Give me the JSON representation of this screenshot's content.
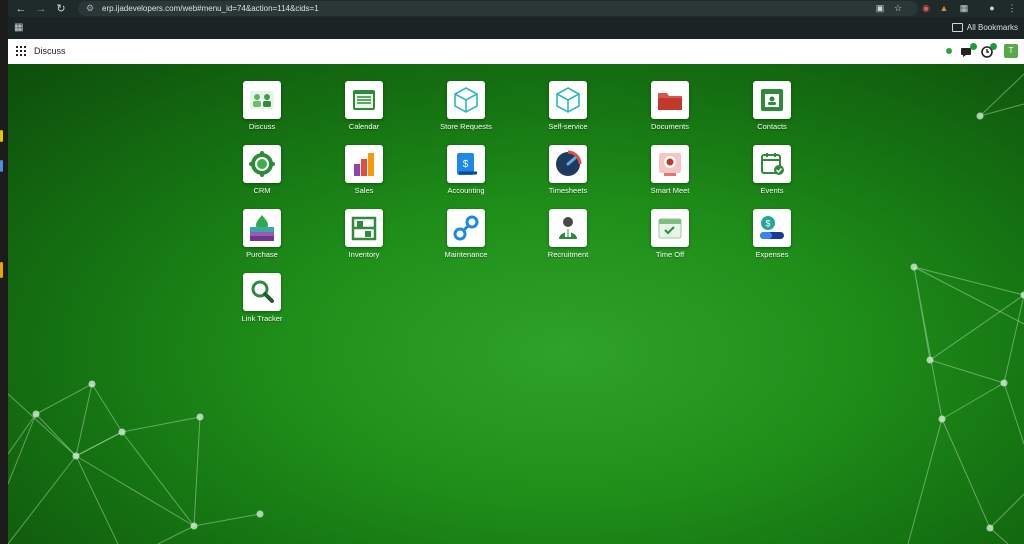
{
  "browser": {
    "url": "erp.ijadevelopers.com/web#menu_id=74&action=114&cids=1",
    "all_bookmarks_label": "All Bookmarks",
    "back_icon": "arrow-left",
    "forward_icon": "arrow-right",
    "reload_icon": "reload"
  },
  "navbar": {
    "title": "Discuss",
    "messages_badge": "",
    "activity_badge": "",
    "avatar_letter": "T",
    "presence_color": "#28a745"
  },
  "apps": [
    {
      "label": "Discuss",
      "icon": "discuss-icon"
    },
    {
      "label": "Calendar",
      "icon": "calendar-icon"
    },
    {
      "label": "Store Requests",
      "icon": "cube-icon"
    },
    {
      "label": "Self-service",
      "icon": "cube-icon"
    },
    {
      "label": "Documents",
      "icon": "folder-icon"
    },
    {
      "label": "Contacts",
      "icon": "contact-card-icon"
    },
    {
      "label": "CRM",
      "icon": "crm-icon"
    },
    {
      "label": "Sales",
      "icon": "bar-chart-icon"
    },
    {
      "label": "Accounting",
      "icon": "dollar-document-icon"
    },
    {
      "label": "Timesheets",
      "icon": "clock-icon"
    },
    {
      "label": "Smart Meet",
      "icon": "camera-icon"
    },
    {
      "label": "Events",
      "icon": "calendar-check-icon"
    },
    {
      "label": "Purchase",
      "icon": "purchase-card-icon"
    },
    {
      "label": "Inventory",
      "icon": "shelves-icon"
    },
    {
      "label": "Maintenance",
      "icon": "wrench-link-icon"
    },
    {
      "label": "Recruitment",
      "icon": "person-icon"
    },
    {
      "label": "Time Off",
      "icon": "time-off-icon"
    },
    {
      "label": "Expenses",
      "icon": "expenses-icon"
    },
    {
      "label": "Link Tracker",
      "icon": "magnifier-icon"
    }
  ],
  "colors": {
    "accent_green": "#1f8f1a",
    "badge_green": "#1e9b3e"
  }
}
